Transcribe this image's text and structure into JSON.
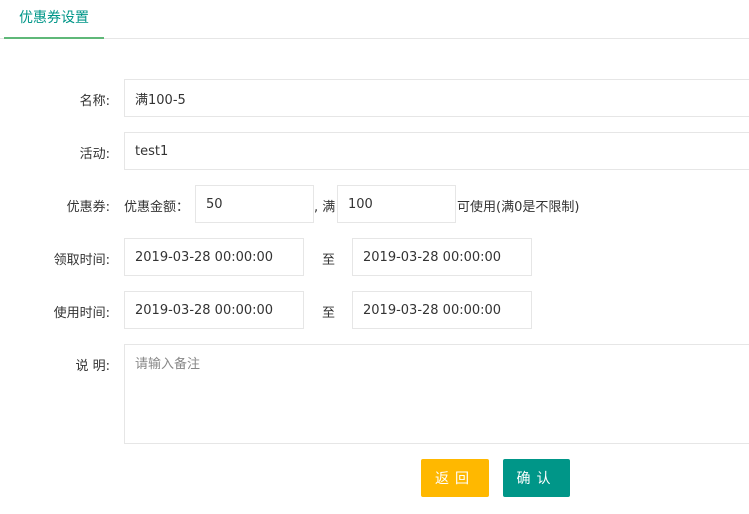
{
  "tabs": [
    {
      "label": "优惠券设置",
      "active": true
    }
  ],
  "form": {
    "name": {
      "label": "名称:",
      "value": "满100-5"
    },
    "activity": {
      "label": "活动:",
      "value": "test1"
    },
    "coupon": {
      "label": "优惠券:",
      "amount_label": "优惠金额：",
      "amount_value": "50",
      "separator": ", 满",
      "threshold_value": "100",
      "suffix": "可使用(满0是不限制)"
    },
    "receive_time": {
      "label": "领取时间:",
      "start": "2019-03-28 00:00:00",
      "to": "至",
      "end": "2019-03-28 00:00:00"
    },
    "use_time": {
      "label": "使用时间:",
      "start": "2019-03-28 00:00:00",
      "to": "至",
      "end": "2019-03-28 00:00:00"
    },
    "description": {
      "label": "说 明:",
      "placeholder": "请输入备注",
      "value": ""
    }
  },
  "buttons": {
    "back": "返回",
    "confirm": "确认"
  },
  "colors": {
    "primary": "#009688",
    "tab_underline": "#5fb878",
    "warning": "#ffb800",
    "border": "#e6e6e6"
  }
}
